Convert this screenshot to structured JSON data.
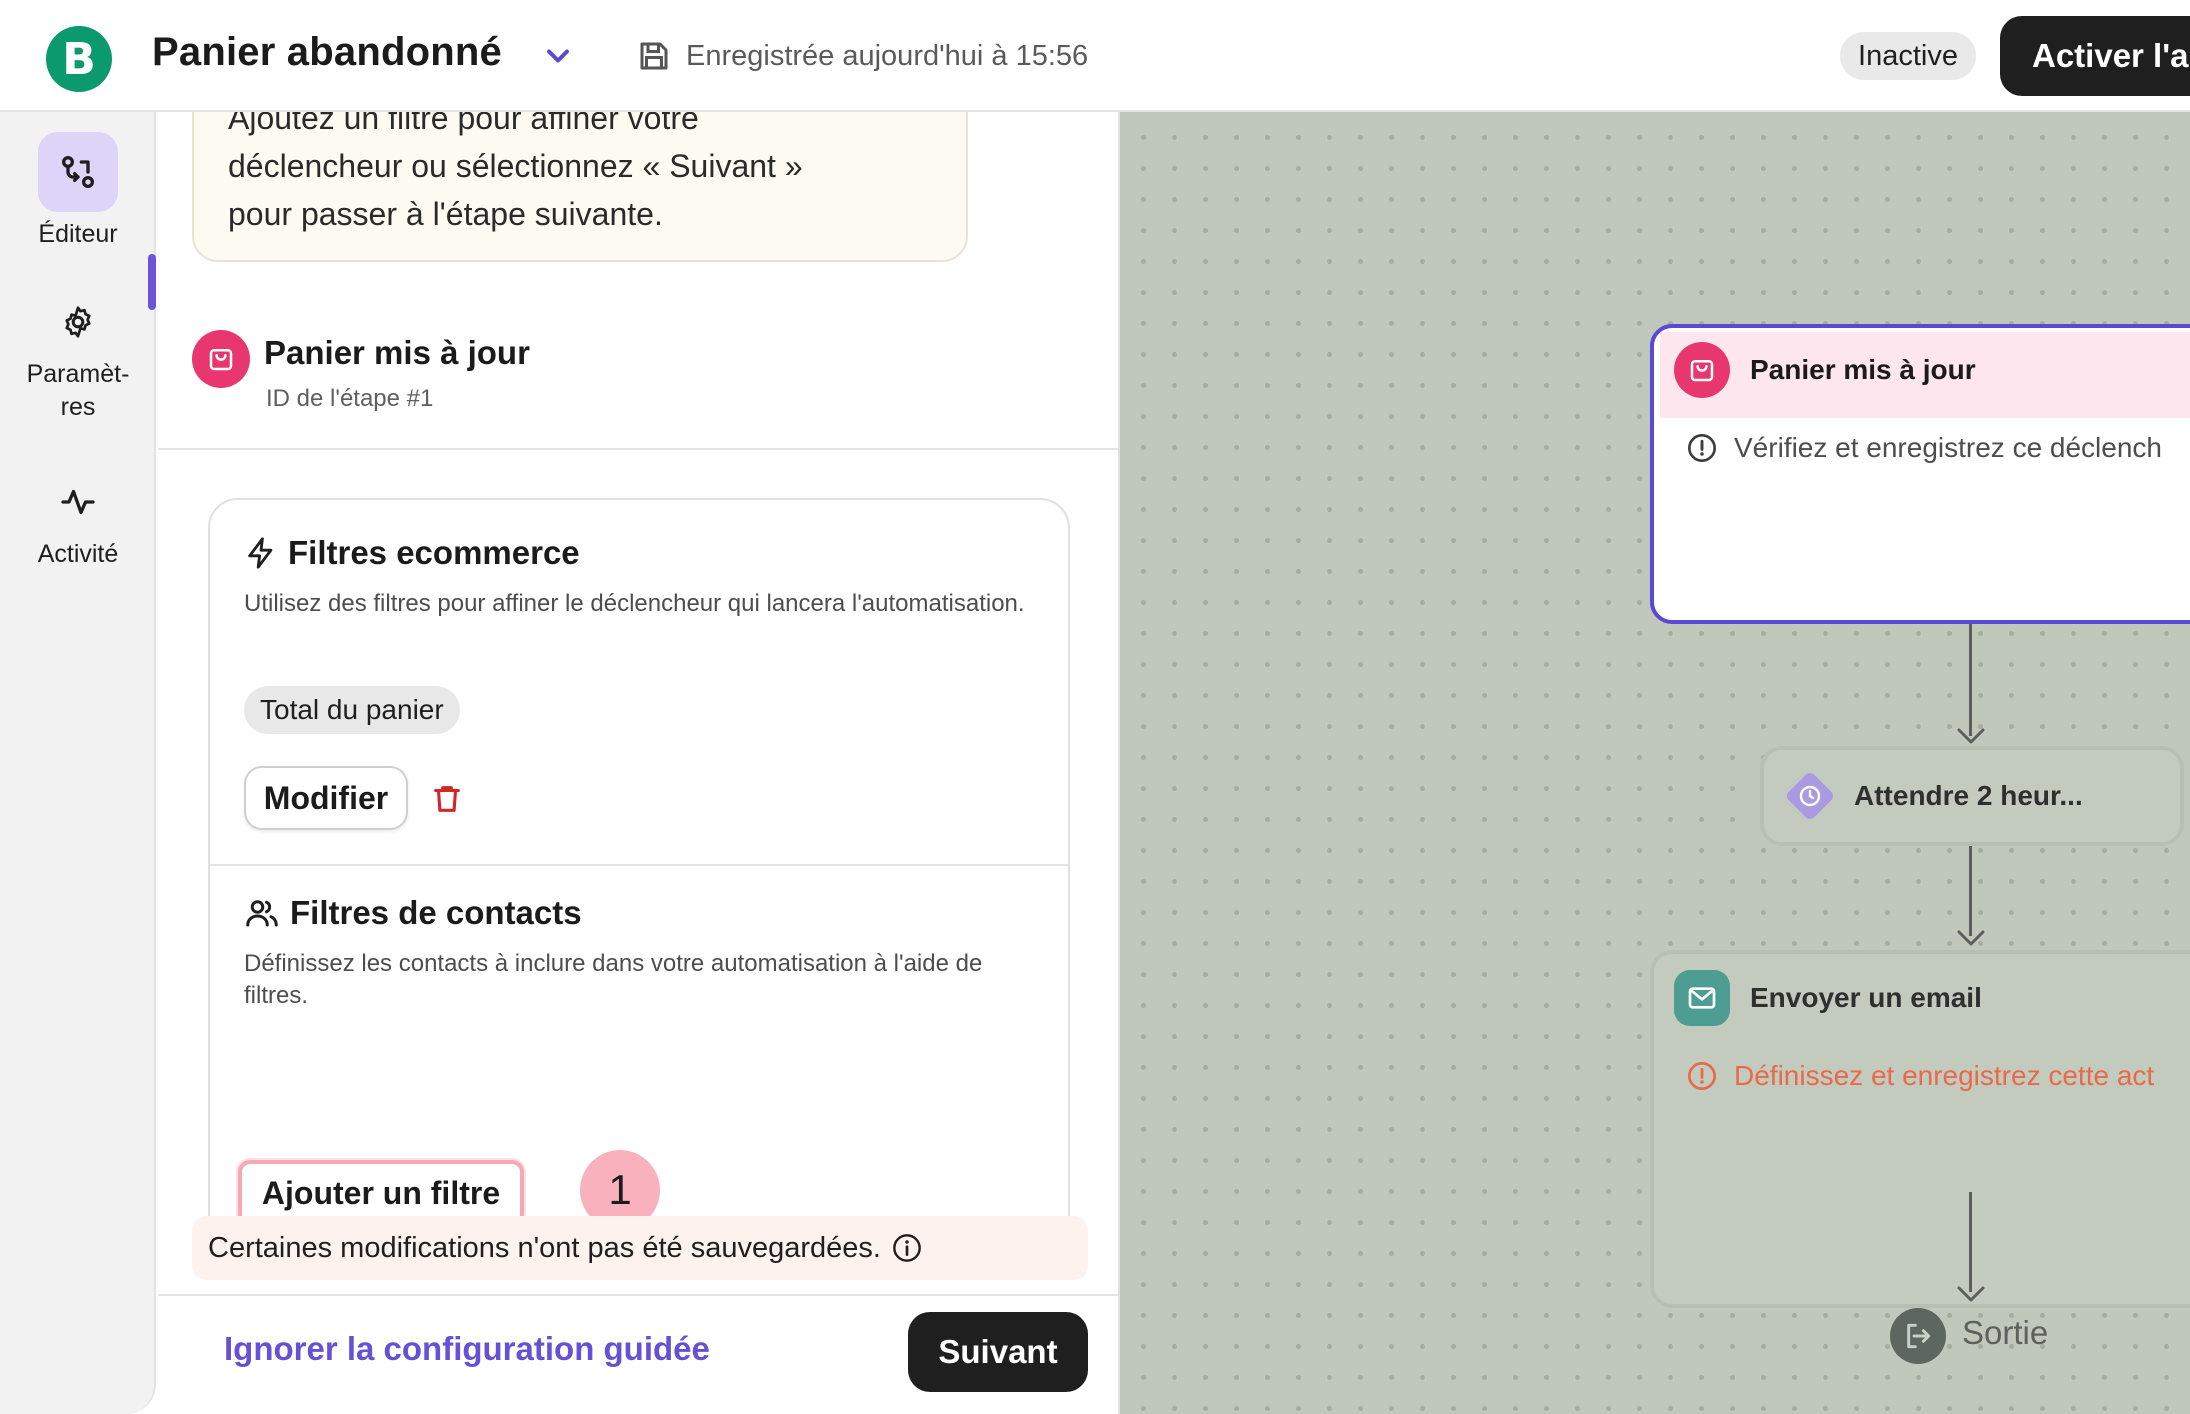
{
  "header": {
    "logo_letter": "B",
    "title": "Panier abandonné",
    "save_status": "Enregistrée aujourd'hui à 15:56",
    "status": "Inactive",
    "activate_label": "Activer l'au"
  },
  "rail": {
    "items": [
      {
        "label": "Éditeur",
        "icon": "editor-flow-icon",
        "active": true
      },
      {
        "label": "Paramèt-\nres",
        "icon": "gear-icon",
        "active": false
      },
      {
        "label": "Activité",
        "icon": "activity-pulse-icon",
        "active": false
      }
    ]
  },
  "panel": {
    "hint_lines": [
      "Ajoutez un filtre pour affiner votre",
      "déclencheur ou sélectionnez « Suivant »",
      "pour passer à l'étape suivante."
    ],
    "trigger": {
      "title": "Panier mis à jour",
      "step_id": "ID de l'étape #1"
    },
    "ecommerce_filters": {
      "title": "Filtres ecommerce",
      "description": "Utilisez des filtres pour affiner le déclencheur qui lancera l'automatisation.",
      "chip": "Total du panier",
      "modify_label": "Modifier"
    },
    "contact_filters": {
      "title": "Filtres de contacts",
      "description": "Définissez les contacts à inclure dans votre automatisation à l'aide de filtres.",
      "add_filter_label": "Ajouter un filtre",
      "step_badge": "1"
    },
    "unsaved_message": "Certaines modifications n'ont pas été sauvegardées.",
    "skip_label": "Ignorer la configuration guidée",
    "next_label": "Suivant"
  },
  "canvas": {
    "trigger_node": {
      "title": "Panier mis à jour",
      "note": "Vérifiez et enregistrez ce déclench"
    },
    "wait_node": {
      "title": "Attendre 2 heur..."
    },
    "email_node": {
      "title": "Envoyer un email",
      "note": "Définissez et enregistrez cette act"
    },
    "exit_node": {
      "label": "Sortie"
    }
  },
  "colors": {
    "brand_green": "#0b996e",
    "accent_purple": "#5b48d4",
    "trigger_pink": "#e8376f",
    "email_teal": "#3f9b8f",
    "warning_orange": "#e86a4a",
    "delete_red": "#d42626"
  }
}
